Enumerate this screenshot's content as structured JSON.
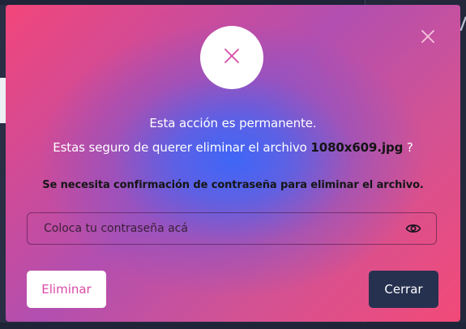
{
  "modal": {
    "message_line1": "Esta acción es permanente.",
    "message_line2_prefix": "Estas seguro de querer eliminar el archivo ",
    "file_name": "1080x609.jpg",
    "message_line2_suffix": " ?",
    "confirmation_note": "Se necesita confirmación de contraseña para eliminar el archivo.",
    "password": {
      "placeholder": "Coloca tu contraseña acá",
      "value": ""
    },
    "buttons": {
      "delete_label": "Eliminar",
      "close_label": "Cerrar"
    }
  },
  "icons": {
    "header": "x-icon",
    "close": "close-icon",
    "password_toggle": "eye-icon"
  },
  "colors": {
    "accent_pink": "#f2467a",
    "accent_blue": "#3f66f7",
    "delete_text": "#d84aa6",
    "close_button": "#263150"
  }
}
